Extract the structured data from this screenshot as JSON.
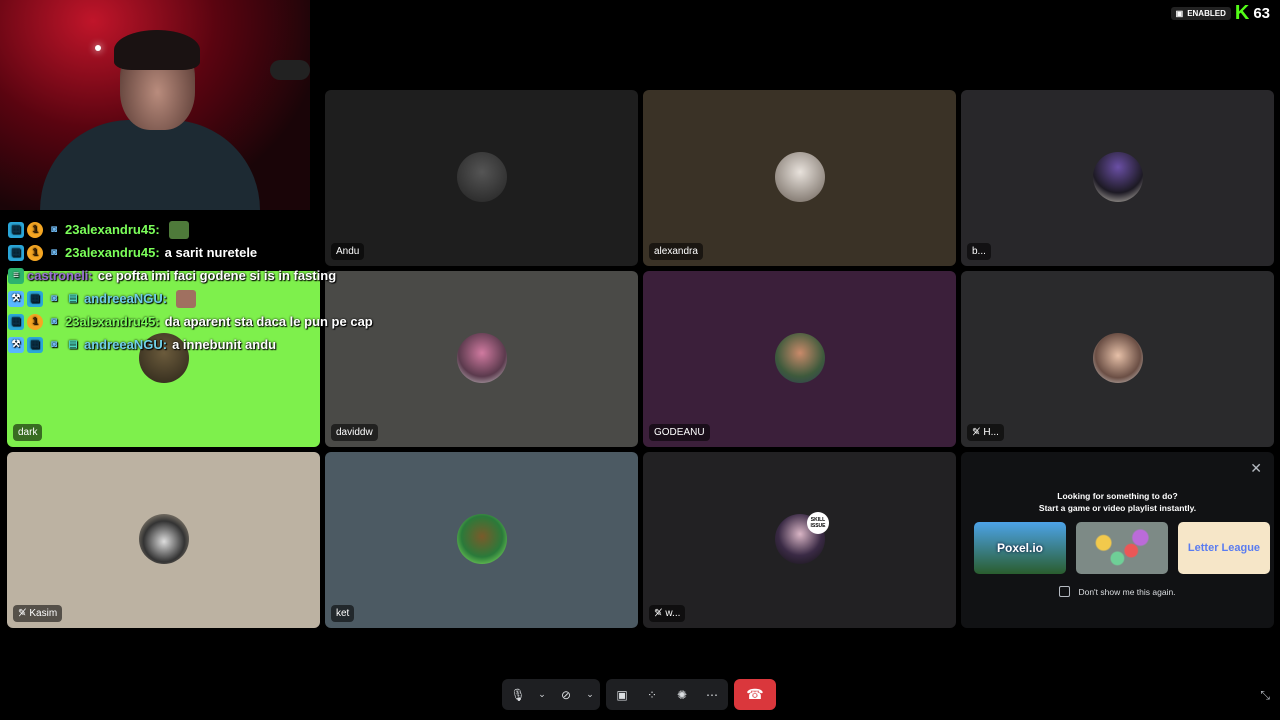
{
  "extension": {
    "status": "ENABLED",
    "count": "63",
    "logo": "K"
  },
  "tiles": [
    {
      "name": "Andu",
      "bg": "#1e1e1e",
      "muted": false
    },
    {
      "name": "alexandra",
      "bg": "#3a3226",
      "muted": false
    },
    {
      "name": "b...",
      "bg": "#28272a",
      "muted": false
    },
    {
      "name": "dark",
      "bg": "#7ef04c",
      "muted": false
    },
    {
      "name": "daviddw",
      "bg": "#4a4a47",
      "muted": false
    },
    {
      "name": "GODEANU",
      "bg": "#3b1f3a",
      "muted": false
    },
    {
      "name": "H...",
      "bg": "#2a2a2c",
      "muted": true
    },
    {
      "name": "Kasim",
      "bg": "#bcb2a2",
      "muted": true
    },
    {
      "name": "ket",
      "bg": "#4c5a63",
      "muted": false
    },
    {
      "name": "w...",
      "bg": "#222123",
      "muted": true
    }
  ],
  "avatar_badge": "SKILL ISSUE",
  "chat": [
    {
      "user": "23alexandru45:",
      "msg": "",
      "color": "#7cff5a"
    },
    {
      "user": "23alexandru45:",
      "msg": "a sarit nuretele",
      "color": "#7cff5a"
    },
    {
      "user": "castroneli:",
      "msg": "ce pofta imi faci godene si is in fasting",
      "color": "#9b6fd6"
    },
    {
      "user": "andreeaNGU:",
      "msg": "",
      "color": "#6fd0e8"
    },
    {
      "user": "23alexandru45:",
      "msg": "da aparent sta daca le pun pe cap",
      "color": "#7cff5a"
    },
    {
      "user": "andreeaNGU:",
      "msg": "a innebunit andu",
      "color": "#6fd0e8"
    }
  ],
  "activity": {
    "title_line1": "Looking for something to do?",
    "title_line2": "Start a game or video playlist instantly.",
    "games": [
      "Poxel.io",
      "",
      "Letter League"
    ],
    "dont_show": "Don't show me this again."
  },
  "controls": {
    "mic_icon": "microphone-icon",
    "camera_icon": "camera-off-icon",
    "share_icon": "screen-share-icon",
    "activities_icon": "activities-icon",
    "soundboard_icon": "soundboard-icon",
    "more_icon": "more-icon",
    "hangup_icon": "hangup-icon"
  }
}
